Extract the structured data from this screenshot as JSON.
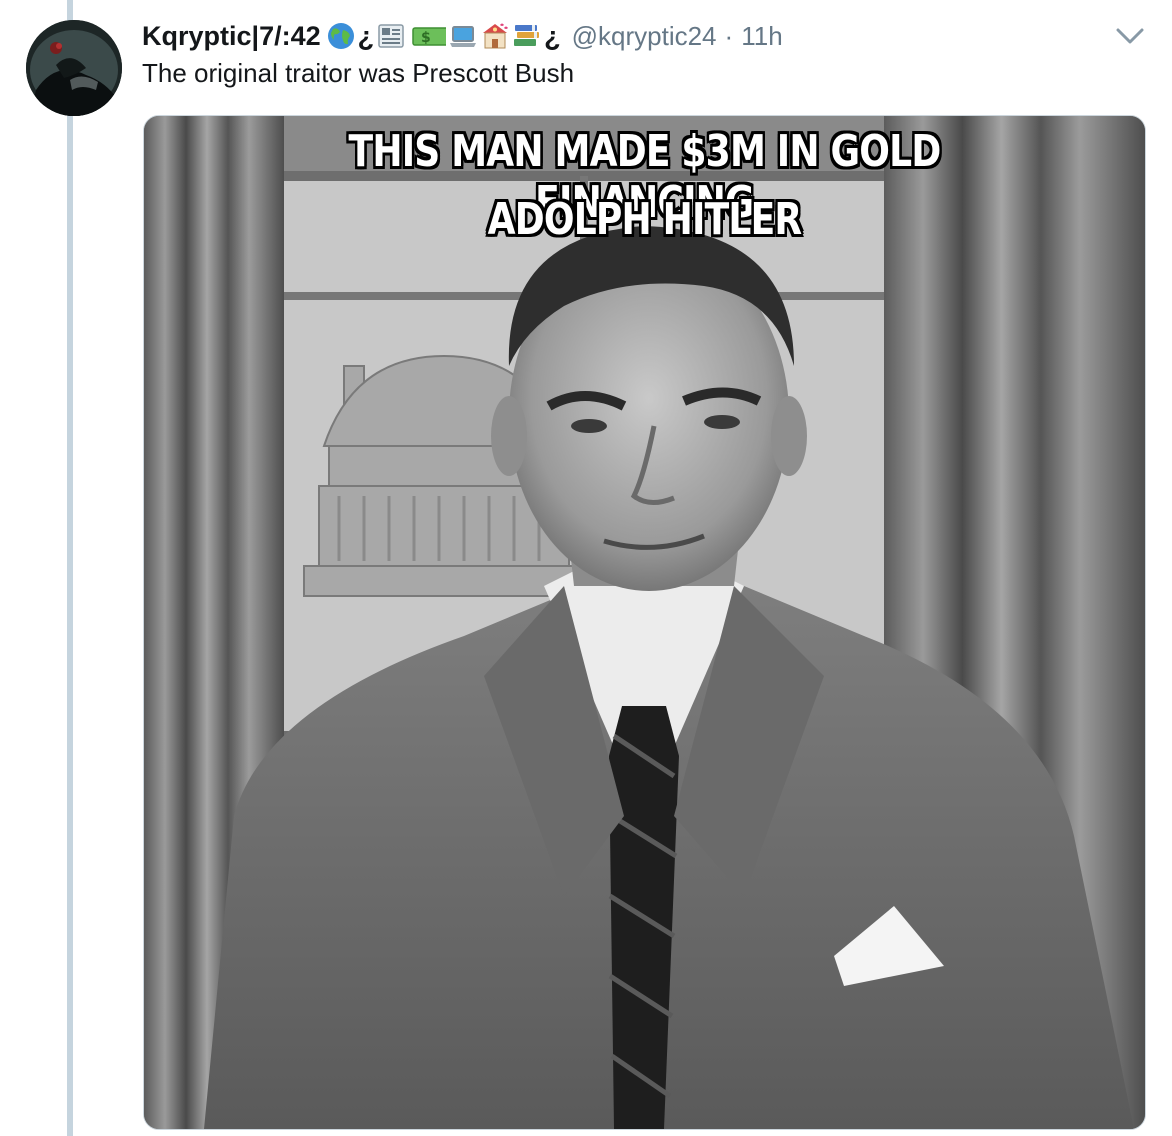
{
  "tweet": {
    "display_name": "Kqryptic|7/:42",
    "name_emoji": [
      "globe-icon",
      "question-mark",
      "newspaper-icon",
      "money-icon",
      "laptop-icon",
      "school-icon",
      "books-icon",
      "question-mark"
    ],
    "question_char": "¿",
    "handle": "@kqryptic24",
    "separator": "·",
    "time": "11h",
    "text": "The original traitor was Prescott Bush"
  },
  "media": {
    "meme_line_1": "THIS MAN MADE $3M IN GOLD FINANCING",
    "meme_line_2": "ADOLPH HITLER"
  },
  "colors": {
    "thread_line": "#c5d4de",
    "secondary_text": "#657786",
    "primary_text": "#14171a"
  }
}
